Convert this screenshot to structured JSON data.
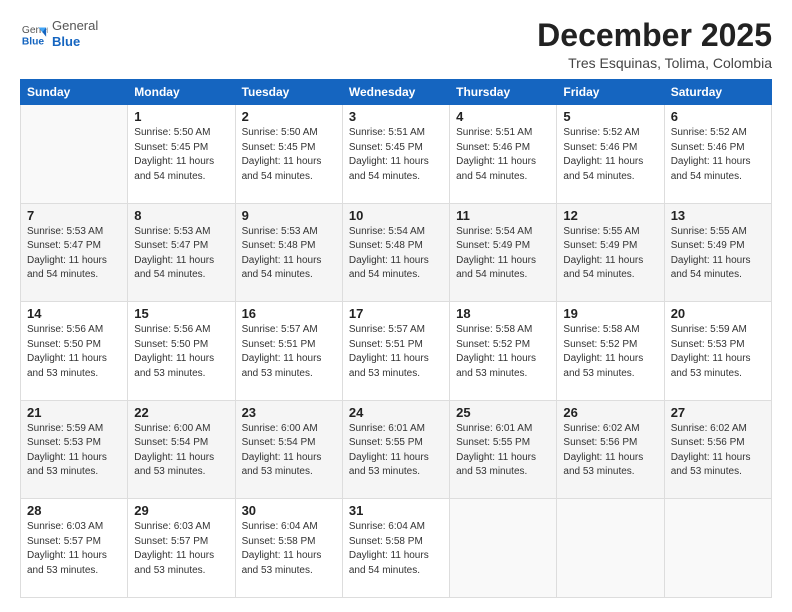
{
  "header": {
    "logo_general": "General",
    "logo_blue": "Blue",
    "month_title": "December 2025",
    "location": "Tres Esquinas, Tolima, Colombia"
  },
  "days_of_week": [
    "Sunday",
    "Monday",
    "Tuesday",
    "Wednesday",
    "Thursday",
    "Friday",
    "Saturday"
  ],
  "weeks": [
    [
      {
        "day": "",
        "info": ""
      },
      {
        "day": "1",
        "info": "Sunrise: 5:50 AM\nSunset: 5:45 PM\nDaylight: 11 hours\nand 54 minutes."
      },
      {
        "day": "2",
        "info": "Sunrise: 5:50 AM\nSunset: 5:45 PM\nDaylight: 11 hours\nand 54 minutes."
      },
      {
        "day": "3",
        "info": "Sunrise: 5:51 AM\nSunset: 5:45 PM\nDaylight: 11 hours\nand 54 minutes."
      },
      {
        "day": "4",
        "info": "Sunrise: 5:51 AM\nSunset: 5:46 PM\nDaylight: 11 hours\nand 54 minutes."
      },
      {
        "day": "5",
        "info": "Sunrise: 5:52 AM\nSunset: 5:46 PM\nDaylight: 11 hours\nand 54 minutes."
      },
      {
        "day": "6",
        "info": "Sunrise: 5:52 AM\nSunset: 5:46 PM\nDaylight: 11 hours\nand 54 minutes."
      }
    ],
    [
      {
        "day": "7",
        "info": "Sunrise: 5:53 AM\nSunset: 5:47 PM\nDaylight: 11 hours\nand 54 minutes."
      },
      {
        "day": "8",
        "info": "Sunrise: 5:53 AM\nSunset: 5:47 PM\nDaylight: 11 hours\nand 54 minutes."
      },
      {
        "day": "9",
        "info": "Sunrise: 5:53 AM\nSunset: 5:48 PM\nDaylight: 11 hours\nand 54 minutes."
      },
      {
        "day": "10",
        "info": "Sunrise: 5:54 AM\nSunset: 5:48 PM\nDaylight: 11 hours\nand 54 minutes."
      },
      {
        "day": "11",
        "info": "Sunrise: 5:54 AM\nSunset: 5:49 PM\nDaylight: 11 hours\nand 54 minutes."
      },
      {
        "day": "12",
        "info": "Sunrise: 5:55 AM\nSunset: 5:49 PM\nDaylight: 11 hours\nand 54 minutes."
      },
      {
        "day": "13",
        "info": "Sunrise: 5:55 AM\nSunset: 5:49 PM\nDaylight: 11 hours\nand 54 minutes."
      }
    ],
    [
      {
        "day": "14",
        "info": "Sunrise: 5:56 AM\nSunset: 5:50 PM\nDaylight: 11 hours\nand 53 minutes."
      },
      {
        "day": "15",
        "info": "Sunrise: 5:56 AM\nSunset: 5:50 PM\nDaylight: 11 hours\nand 53 minutes."
      },
      {
        "day": "16",
        "info": "Sunrise: 5:57 AM\nSunset: 5:51 PM\nDaylight: 11 hours\nand 53 minutes."
      },
      {
        "day": "17",
        "info": "Sunrise: 5:57 AM\nSunset: 5:51 PM\nDaylight: 11 hours\nand 53 minutes."
      },
      {
        "day": "18",
        "info": "Sunrise: 5:58 AM\nSunset: 5:52 PM\nDaylight: 11 hours\nand 53 minutes."
      },
      {
        "day": "19",
        "info": "Sunrise: 5:58 AM\nSunset: 5:52 PM\nDaylight: 11 hours\nand 53 minutes."
      },
      {
        "day": "20",
        "info": "Sunrise: 5:59 AM\nSunset: 5:53 PM\nDaylight: 11 hours\nand 53 minutes."
      }
    ],
    [
      {
        "day": "21",
        "info": "Sunrise: 5:59 AM\nSunset: 5:53 PM\nDaylight: 11 hours\nand 53 minutes."
      },
      {
        "day": "22",
        "info": "Sunrise: 6:00 AM\nSunset: 5:54 PM\nDaylight: 11 hours\nand 53 minutes."
      },
      {
        "day": "23",
        "info": "Sunrise: 6:00 AM\nSunset: 5:54 PM\nDaylight: 11 hours\nand 53 minutes."
      },
      {
        "day": "24",
        "info": "Sunrise: 6:01 AM\nSunset: 5:55 PM\nDaylight: 11 hours\nand 53 minutes."
      },
      {
        "day": "25",
        "info": "Sunrise: 6:01 AM\nSunset: 5:55 PM\nDaylight: 11 hours\nand 53 minutes."
      },
      {
        "day": "26",
        "info": "Sunrise: 6:02 AM\nSunset: 5:56 PM\nDaylight: 11 hours\nand 53 minutes."
      },
      {
        "day": "27",
        "info": "Sunrise: 6:02 AM\nSunset: 5:56 PM\nDaylight: 11 hours\nand 53 minutes."
      }
    ],
    [
      {
        "day": "28",
        "info": "Sunrise: 6:03 AM\nSunset: 5:57 PM\nDaylight: 11 hours\nand 53 minutes."
      },
      {
        "day": "29",
        "info": "Sunrise: 6:03 AM\nSunset: 5:57 PM\nDaylight: 11 hours\nand 53 minutes."
      },
      {
        "day": "30",
        "info": "Sunrise: 6:04 AM\nSunset: 5:58 PM\nDaylight: 11 hours\nand 53 minutes."
      },
      {
        "day": "31",
        "info": "Sunrise: 6:04 AM\nSunset: 5:58 PM\nDaylight: 11 hours\nand 54 minutes."
      },
      {
        "day": "",
        "info": ""
      },
      {
        "day": "",
        "info": ""
      },
      {
        "day": "",
        "info": ""
      }
    ]
  ]
}
